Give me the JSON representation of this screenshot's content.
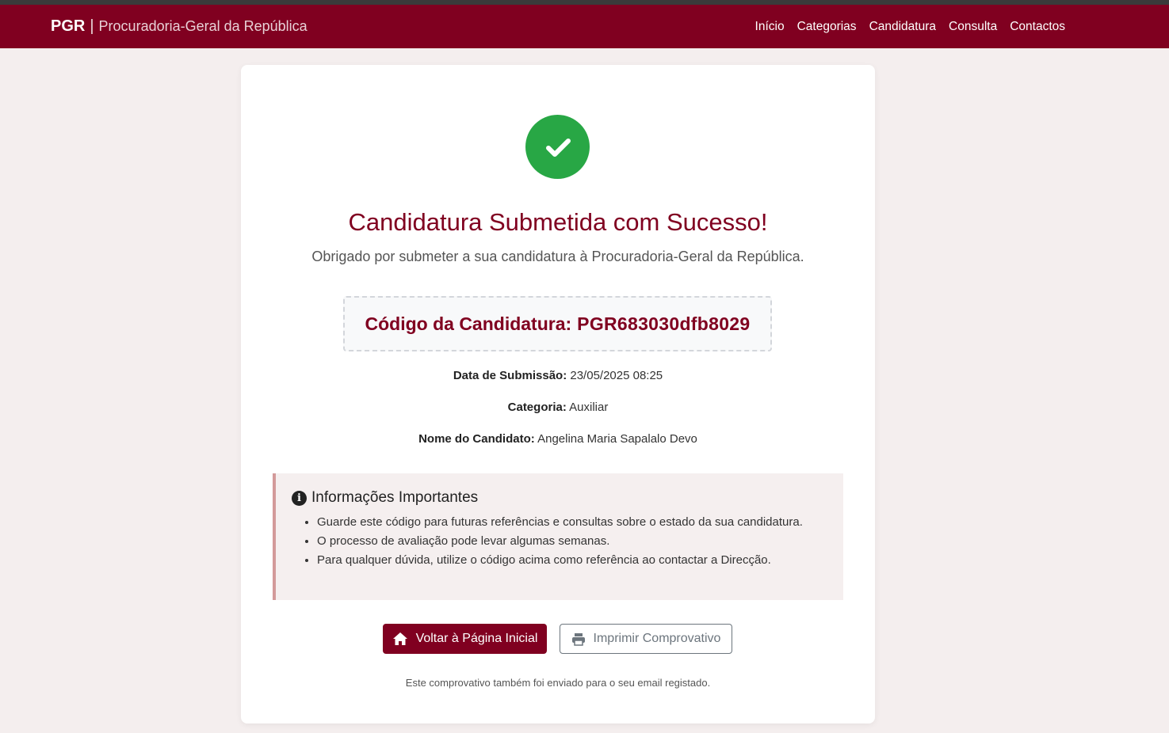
{
  "navbar": {
    "brand_abbr": "PGR",
    "brand_sep": "|",
    "brand_name": "Procuradoria-Geral da República",
    "links": [
      "Início",
      "Categorias",
      "Candidatura",
      "Consulta",
      "Contactos"
    ]
  },
  "success": {
    "icon": "check-icon",
    "title": "Candidatura Submetida com Sucesso!",
    "subtitle": "Obrigado por submeter a sua candidatura à Procuradoria-Geral da República."
  },
  "code": {
    "label": "Código da Candidatura:",
    "value": "PGR683030dfb8029"
  },
  "details": {
    "date_label": "Data de Submissão:",
    "date_value": "23/05/2025 08:25",
    "category_label": "Categoria:",
    "category_value": "Auxiliar",
    "name_label": "Nome do Candidato:",
    "name_value": "Angelina Maria Sapalalo Devo"
  },
  "info": {
    "title": "Informações Importantes",
    "items": [
      "Guarde este código para futuras referências e consultas sobre o estado da sua candidatura.",
      "O processo de avaliação pode levar algumas semanas.",
      "Para qualquer dúvida, utilize o código acima como referência ao contactar a Direcção."
    ]
  },
  "actions": {
    "home_label": "Voltar à Página Inicial",
    "print_label": "Imprimir Comprovativo"
  },
  "footnote": "Este comprovativo também foi enviado para o seu email registado.",
  "colors": {
    "brand": "#800020",
    "success": "#28a745",
    "page_bg": "#f4eeee"
  }
}
